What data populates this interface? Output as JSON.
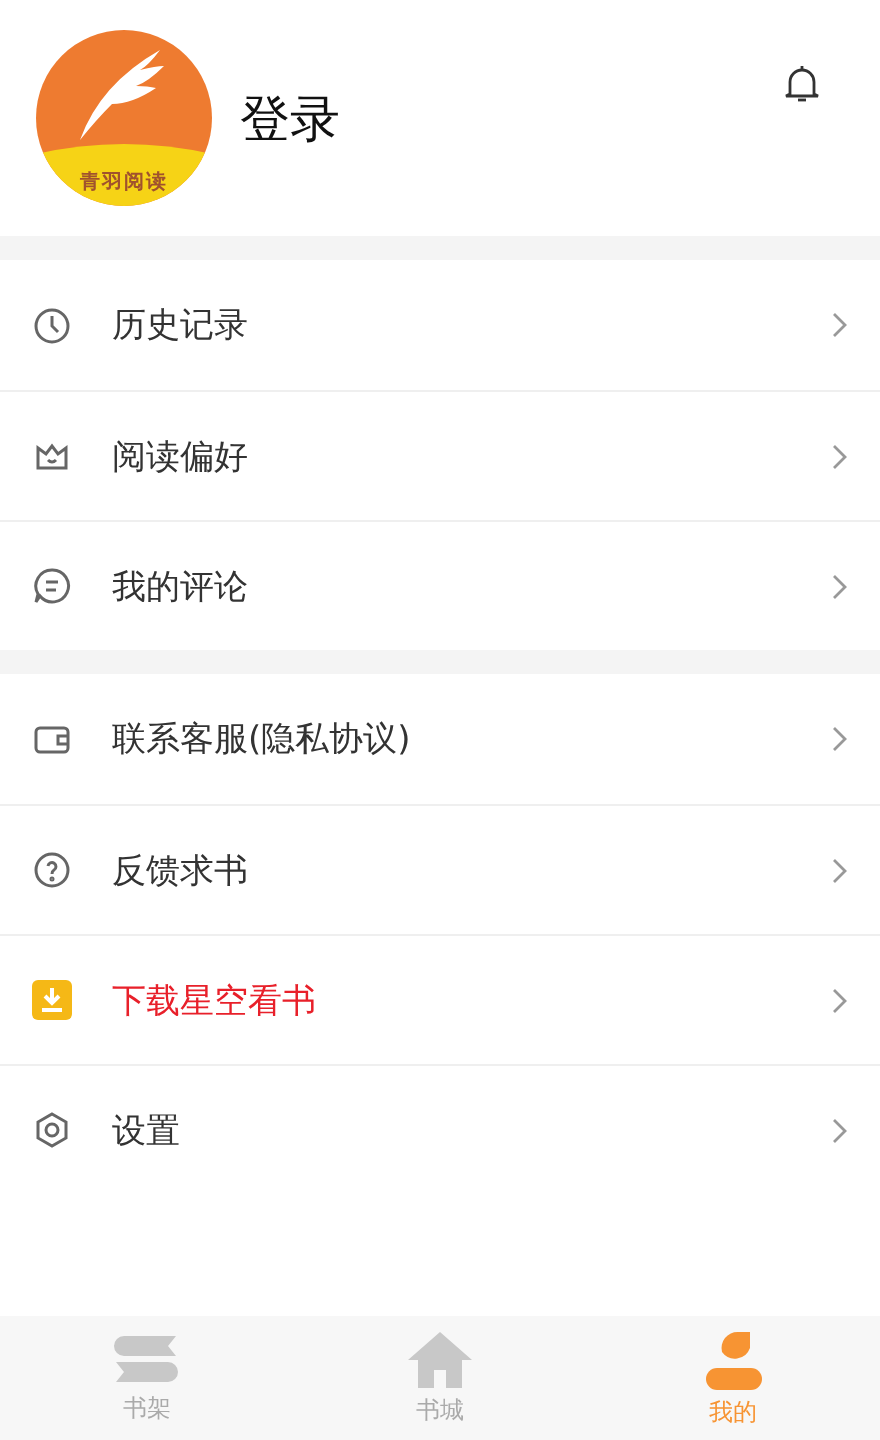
{
  "profile": {
    "logo_text": "青羽阅读",
    "login": "登录"
  },
  "menu_groups": [
    {
      "items": [
        {
          "kind": "clock",
          "label": "历史记录",
          "highlight": false
        },
        {
          "kind": "crown",
          "label": "阅读偏好",
          "highlight": false
        },
        {
          "kind": "chat",
          "label": "我的评论",
          "highlight": false
        }
      ]
    },
    {
      "items": [
        {
          "kind": "wallet",
          "label": "联系客服(隐私协议)",
          "highlight": false
        },
        {
          "kind": "help",
          "label": "反馈求书",
          "highlight": false
        },
        {
          "kind": "download",
          "label": "下载星空看书",
          "highlight": true
        },
        {
          "kind": "gear",
          "label": "设置",
          "highlight": false
        }
      ]
    }
  ],
  "tab_bar": [
    {
      "kind": "shelf",
      "label": "书架",
      "selected": false
    },
    {
      "kind": "home",
      "label": "书城",
      "selected": false
    },
    {
      "kind": "person",
      "label": "我的",
      "selected": true
    }
  ]
}
